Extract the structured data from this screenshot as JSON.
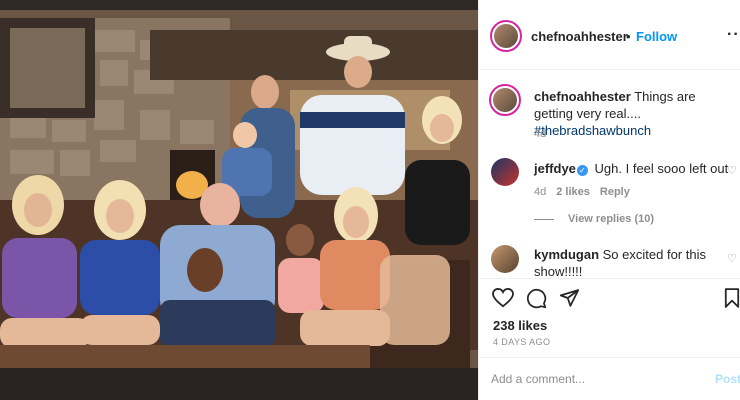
{
  "post": {
    "username": "chefnoahhester",
    "follow_label": "Follow",
    "dot": "•",
    "more_icon": "more-options-icon",
    "more_glyph": "···"
  },
  "caption": {
    "username": "chefnoahhester",
    "text": "Things are getting very real....",
    "hashtag": "#thebradshawbunch",
    "time": "4d"
  },
  "comments": [
    {
      "username": "jeffdye",
      "verified": true,
      "text": "Ugh. I feel sooo left out",
      "time": "4d",
      "likes": "2 likes",
      "reply_label": "Reply",
      "view_replies": "View replies (10)"
    },
    {
      "username": "kymdugan",
      "verified": false,
      "text": "So excited for this show!!!!!"
    }
  ],
  "actions": {
    "like_icon": "heart-icon",
    "comment_icon": "comment-icon",
    "share_icon": "share-icon",
    "save_icon": "bookmark-icon"
  },
  "likes_label": "238 likes",
  "date_label": "4 DAYS AGO",
  "add_comment": {
    "placeholder": "Add a comment...",
    "post_label": "Post"
  },
  "colors": {
    "accent_blue": "#0095f6",
    "hashtag": "#00376b",
    "muted": "#8e8e8e",
    "story_ring": "#d6249f"
  }
}
